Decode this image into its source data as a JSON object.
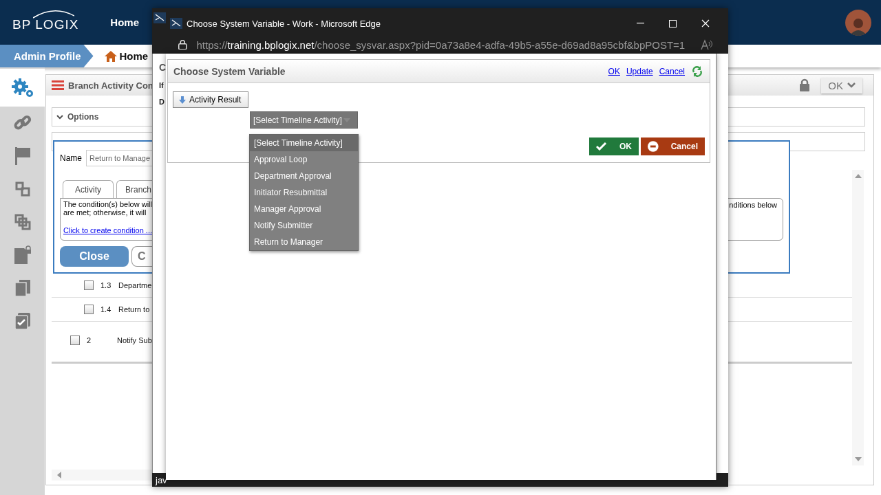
{
  "header": {
    "logo": "BP LOGIX",
    "nav": [
      {
        "label": "Home"
      }
    ]
  },
  "breadcrumb": [
    {
      "label": "Admin Profile",
      "selected": true
    },
    {
      "label": "Home",
      "selected": false
    }
  ],
  "sidebar": {
    "items": [
      {
        "selected": true
      },
      {
        "selected": false
      },
      {
        "selected": false
      },
      {
        "selected": false
      },
      {
        "selected": false
      },
      {
        "selected": false
      },
      {
        "selected": false
      },
      {
        "selected": false
      }
    ]
  },
  "panel": {
    "title": "Branch Activity Con",
    "action": "OK",
    "sections": [
      {
        "label": "Options",
        "expanded": true
      }
    ]
  },
  "branch_editor": {
    "name_label": "Name",
    "name_value": "Return to Manage",
    "tabs": [
      {
        "label": "Activity"
      },
      {
        "label": "Branch"
      }
    ],
    "condition_lines": [
      "The condition(s) below will",
      "are met; otherwise, it will"
    ],
    "condition_tail": "nditions below",
    "link": "Click to create condition ...",
    "buttons": [
      {
        "label": "Close",
        "kind": "primary"
      },
      {
        "label": "C",
        "kind": "secondary"
      }
    ]
  },
  "rows": [
    {
      "number": "1.3",
      "label": "Departme",
      "kind": "sub",
      "checked": false
    },
    {
      "number": "1.4",
      "label": "Return to",
      "kind": "sub",
      "checked": false
    },
    {
      "number": "2",
      "label": "Notify Sub",
      "kind": "main",
      "checked": false
    }
  ],
  "back_window": {
    "fragments": [
      "C",
      "If",
      "D"
    ],
    "status": "jav"
  },
  "popup": {
    "title": "Choose System Variable - Work - Microsoft Edge",
    "url": {
      "scheme": "https://",
      "host": "training.bplogix.net",
      "path": "/choose_sysvar.aspx?pid=0a73a8e4-adfa-49b5-a55e-d69ad8a95cbf&bpPOST=1"
    },
    "page": {
      "title": "Choose System Variable",
      "links": [
        "OK",
        "Update",
        "Cancel"
      ],
      "variable_button": "Activity Result",
      "select": {
        "value": "[Select Timeline Activity]",
        "expanded": true,
        "options": [
          {
            "label": "[Select Timeline Activity]",
            "selected": true
          },
          {
            "label": "Approval Loop",
            "selected": false
          },
          {
            "label": "Department Approval",
            "selected": false
          },
          {
            "label": "Initiator Resubmittal",
            "selected": false
          },
          {
            "label": "Manager Approval",
            "selected": false
          },
          {
            "label": "Notify Submitter",
            "selected": false
          },
          {
            "label": "Return to Manager",
            "selected": false
          }
        ]
      },
      "buttons": [
        {
          "label": "OK",
          "kind": "ok"
        },
        {
          "label": "Cancel",
          "kind": "cancel"
        }
      ]
    }
  }
}
